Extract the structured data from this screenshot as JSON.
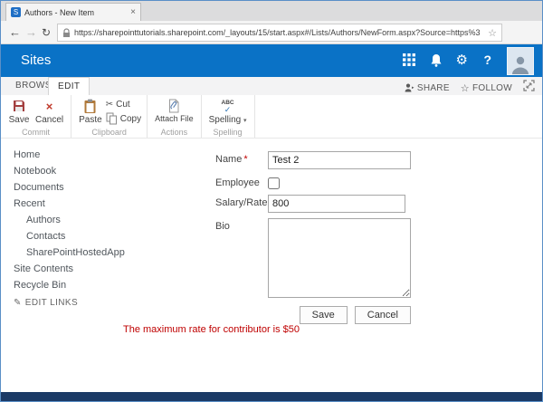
{
  "browser": {
    "tab_title": "Authors - New Item",
    "url": "https://sharepointtutorials.sharepoint.com/_layouts/15/start.aspx#/Lists/Authors/NewForm.aspx?Source=https%3"
  },
  "suite_bar": {
    "title": "Sites"
  },
  "ribbon_tabs": {
    "browse": "BROWSE",
    "edit": "EDIT",
    "share": "SHARE",
    "follow": "FOLLOW"
  },
  "ribbon": {
    "commit": {
      "group_label": "Commit",
      "save": "Save",
      "cancel": "Cancel"
    },
    "clipboard": {
      "group_label": "Clipboard",
      "paste": "Paste",
      "cut": "Cut",
      "copy": "Copy"
    },
    "actions": {
      "group_label": "Actions",
      "attach": "Attach File"
    },
    "spelling": {
      "group_label": "Spelling",
      "button": "Spelling"
    }
  },
  "sidebar": {
    "items": [
      {
        "label": "Home"
      },
      {
        "label": "Notebook"
      },
      {
        "label": "Documents"
      },
      {
        "label": "Recent"
      },
      {
        "label": "Authors"
      },
      {
        "label": "Contacts"
      },
      {
        "label": "SharePointHostedApp"
      },
      {
        "label": "Site Contents"
      },
      {
        "label": "Recycle Bin"
      }
    ],
    "edit_links": "EDIT LINKS"
  },
  "form": {
    "name_label": "Name",
    "employee_label": "Employee",
    "salary_label": "Salary/Rate",
    "bio_label": "Bio",
    "required_marker": "*",
    "name_value": "Test 2",
    "salary_value": "800",
    "save_button": "Save",
    "cancel_button": "Cancel",
    "error_message": "The maximum rate for contributor is $50"
  },
  "icons": {
    "sharepoint_logo": "S",
    "close": "×",
    "back": "←",
    "forward": "→",
    "refresh": "↻",
    "favorite_star": "☆",
    "gear": "⚙",
    "help": "?",
    "cancel_x": "×",
    "scissors": "✂",
    "abc": "ABC",
    "check": "✓",
    "dropdown": "▾",
    "follow_star": "☆",
    "pencil": "✎"
  }
}
